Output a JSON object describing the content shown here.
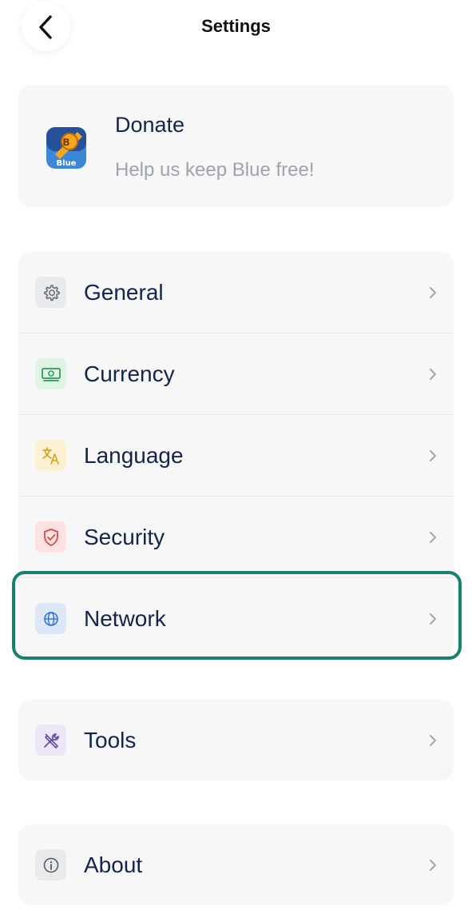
{
  "header": {
    "title": "Settings",
    "back_icon": "chevron-left-icon"
  },
  "donate": {
    "title": "Donate",
    "subtitle": "Help us keep Blue free!",
    "logo_text": "Blue"
  },
  "main_settings": [
    {
      "label": "General",
      "icon": "gear-icon",
      "icon_bg": "#e9eaec",
      "icon_color": "#6b6f78"
    },
    {
      "label": "Currency",
      "icon": "money-icon",
      "icon_bg": "#dff4e5",
      "icon_color": "#2e9b5a"
    },
    {
      "label": "Language",
      "icon": "translate-icon",
      "icon_bg": "#fdf1d3",
      "icon_color": "#d4a017"
    },
    {
      "label": "Security",
      "icon": "shield-check-icon",
      "icon_bg": "#fde2e2",
      "icon_color": "#d94848"
    },
    {
      "label": "Network",
      "icon": "network-icon",
      "icon_bg": "#dde7f7",
      "icon_color": "#2f6fd6"
    }
  ],
  "tools": {
    "label": "Tools",
    "icon": "tools-icon",
    "icon_bg": "#ece6f6",
    "icon_color": "#6a4aa3"
  },
  "about": {
    "label": "About",
    "icon": "info-icon",
    "icon_bg": "#e9eaec",
    "icon_color": "#555a63"
  },
  "colors": {
    "highlight_border": "#16826b",
    "text_primary": "#13244d",
    "text_secondary": "#9ea3ae"
  }
}
